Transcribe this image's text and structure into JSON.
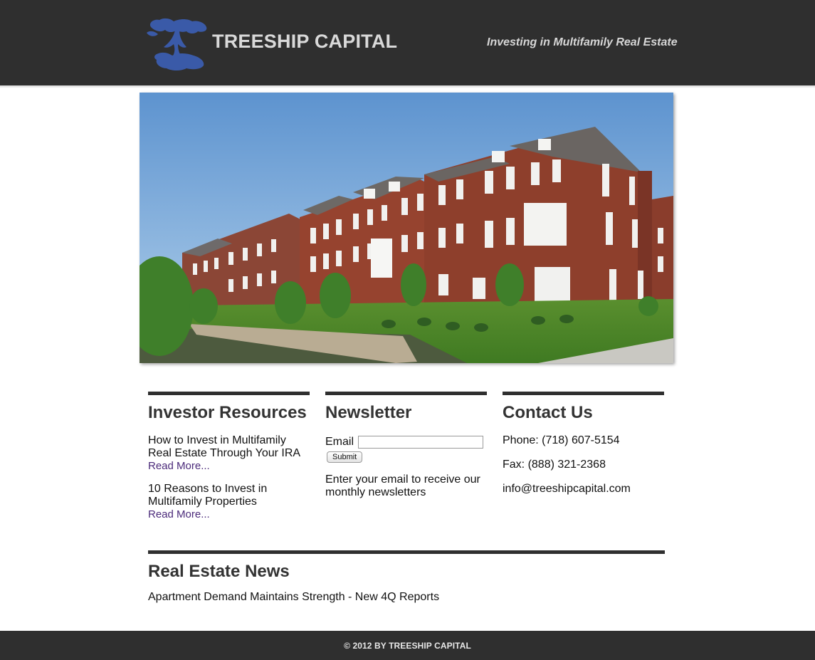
{
  "header": {
    "brand": "TREESHIP CAPITAL",
    "tagline": "Investing in Multifamily Real Estate",
    "logo_icon": "tree-logo-icon",
    "logo_color": "#3a5aa8"
  },
  "hero": {
    "image": "brick-townhouses-photo"
  },
  "investor_resources": {
    "heading": "Investor Resources",
    "articles": [
      {
        "title": "How to Invest in Multifamily Real Estate Through Your IRA",
        "link": "Read More..."
      },
      {
        "title": "10 Reasons to Invest in Multifamily Properties",
        "link": "Read More..."
      }
    ]
  },
  "newsletter": {
    "heading": "Newsletter",
    "email_label": "Email",
    "email_value": "",
    "submit_label": "Submit",
    "note": "Enter your email to receive our monthly newsletters"
  },
  "contact": {
    "heading": "Contact Us",
    "phone": "Phone: (718) 607-5154",
    "fax": "Fax: (888) 321-2368",
    "email": "info@treeshipcapital.com"
  },
  "news": {
    "heading": "Real Estate News",
    "items": [
      "Apartment Demand Maintains Strength - New 4Q Reports"
    ]
  },
  "footer": {
    "text": "© 2012 BY TREESHIP CAPITAL"
  },
  "colors": {
    "header_bg": "#2f2f2f",
    "link": "#4b2a7a"
  }
}
